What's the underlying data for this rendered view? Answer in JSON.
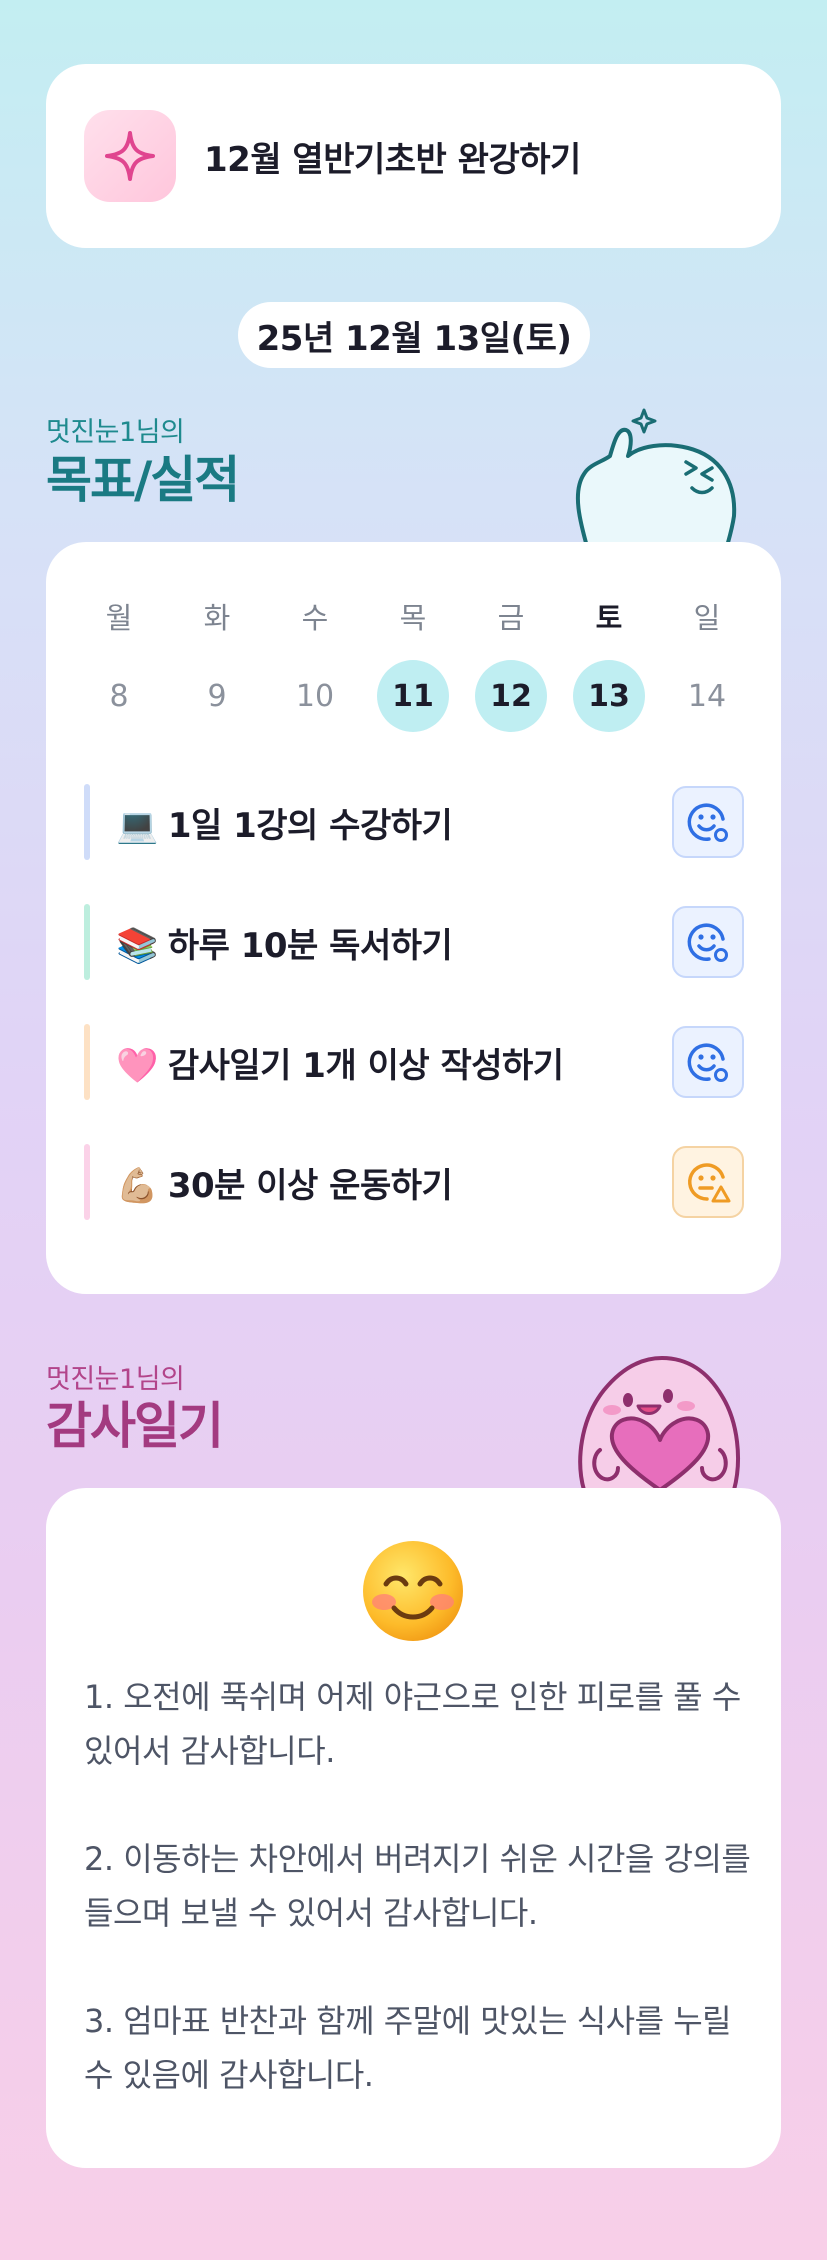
{
  "goal": {
    "icon": "sparkle-icon",
    "text": "12월 열반기초반 완강하기"
  },
  "date": "25년 12월 13일(토)",
  "performance": {
    "subtitle": "멋진눈1님의",
    "title": "목표/실적",
    "mascot": "waving-ghost-mascot"
  },
  "week": [
    {
      "weekday": "월",
      "date": "8",
      "done": false,
      "today": false
    },
    {
      "weekday": "화",
      "date": "9",
      "done": false,
      "today": false
    },
    {
      "weekday": "수",
      "date": "10",
      "done": false,
      "today": false
    },
    {
      "weekday": "목",
      "date": "11",
      "done": true,
      "today": false
    },
    {
      "weekday": "금",
      "date": "12",
      "done": true,
      "today": false
    },
    {
      "weekday": "토",
      "date": "13",
      "done": true,
      "today": true
    },
    {
      "weekday": "일",
      "date": "14",
      "done": false,
      "today": false
    }
  ],
  "tasks": [
    {
      "emoji": "💻",
      "label": "1일 1강의 수강하기",
      "status": "achieved",
      "status_icon": "smile-face-icon",
      "bar_color": "#cfdcf9"
    },
    {
      "emoji": "📚",
      "label": "하루 10분 독서하기",
      "status": "achieved",
      "status_icon": "smile-face-icon",
      "bar_color": "#bdeede"
    },
    {
      "emoji": "🩷",
      "label": "감사일기 1개 이상 작성하기",
      "status": "achieved",
      "status_icon": "smile-face-icon",
      "bar_color": "#fde1c4"
    },
    {
      "emoji": "💪🏼",
      "label": "30분 이상 운동하기",
      "status": "partial",
      "status_icon": "warning-face-icon",
      "bar_color": "#fbd2e8"
    }
  ],
  "gratitude": {
    "subtitle": "멋진눈1님의",
    "title": "감사일기",
    "mascot": "heart-holding-mascot",
    "emoji": "smiling-face-emoji",
    "entries": [
      "1. 오전에 푹쉬며 어제 야근으로 인한 피로를 풀 수 있어서 감사합니다.",
      "2. 이동하는 차안에서 버려지기 쉬운 시간을 강의를 들으며 보낼 수 있어서 감사합니다.",
      "3. 엄마표 반찬과 함께 주말에 맛있는 식사를 누릴 수 있음에 감사합니다."
    ]
  },
  "colors": {
    "teal": "#1a7a83",
    "magenta": "#a33a80",
    "done_day": "#bfeef2",
    "status_blue": "#2f6fe4",
    "status_orange": "#ef9b24"
  }
}
